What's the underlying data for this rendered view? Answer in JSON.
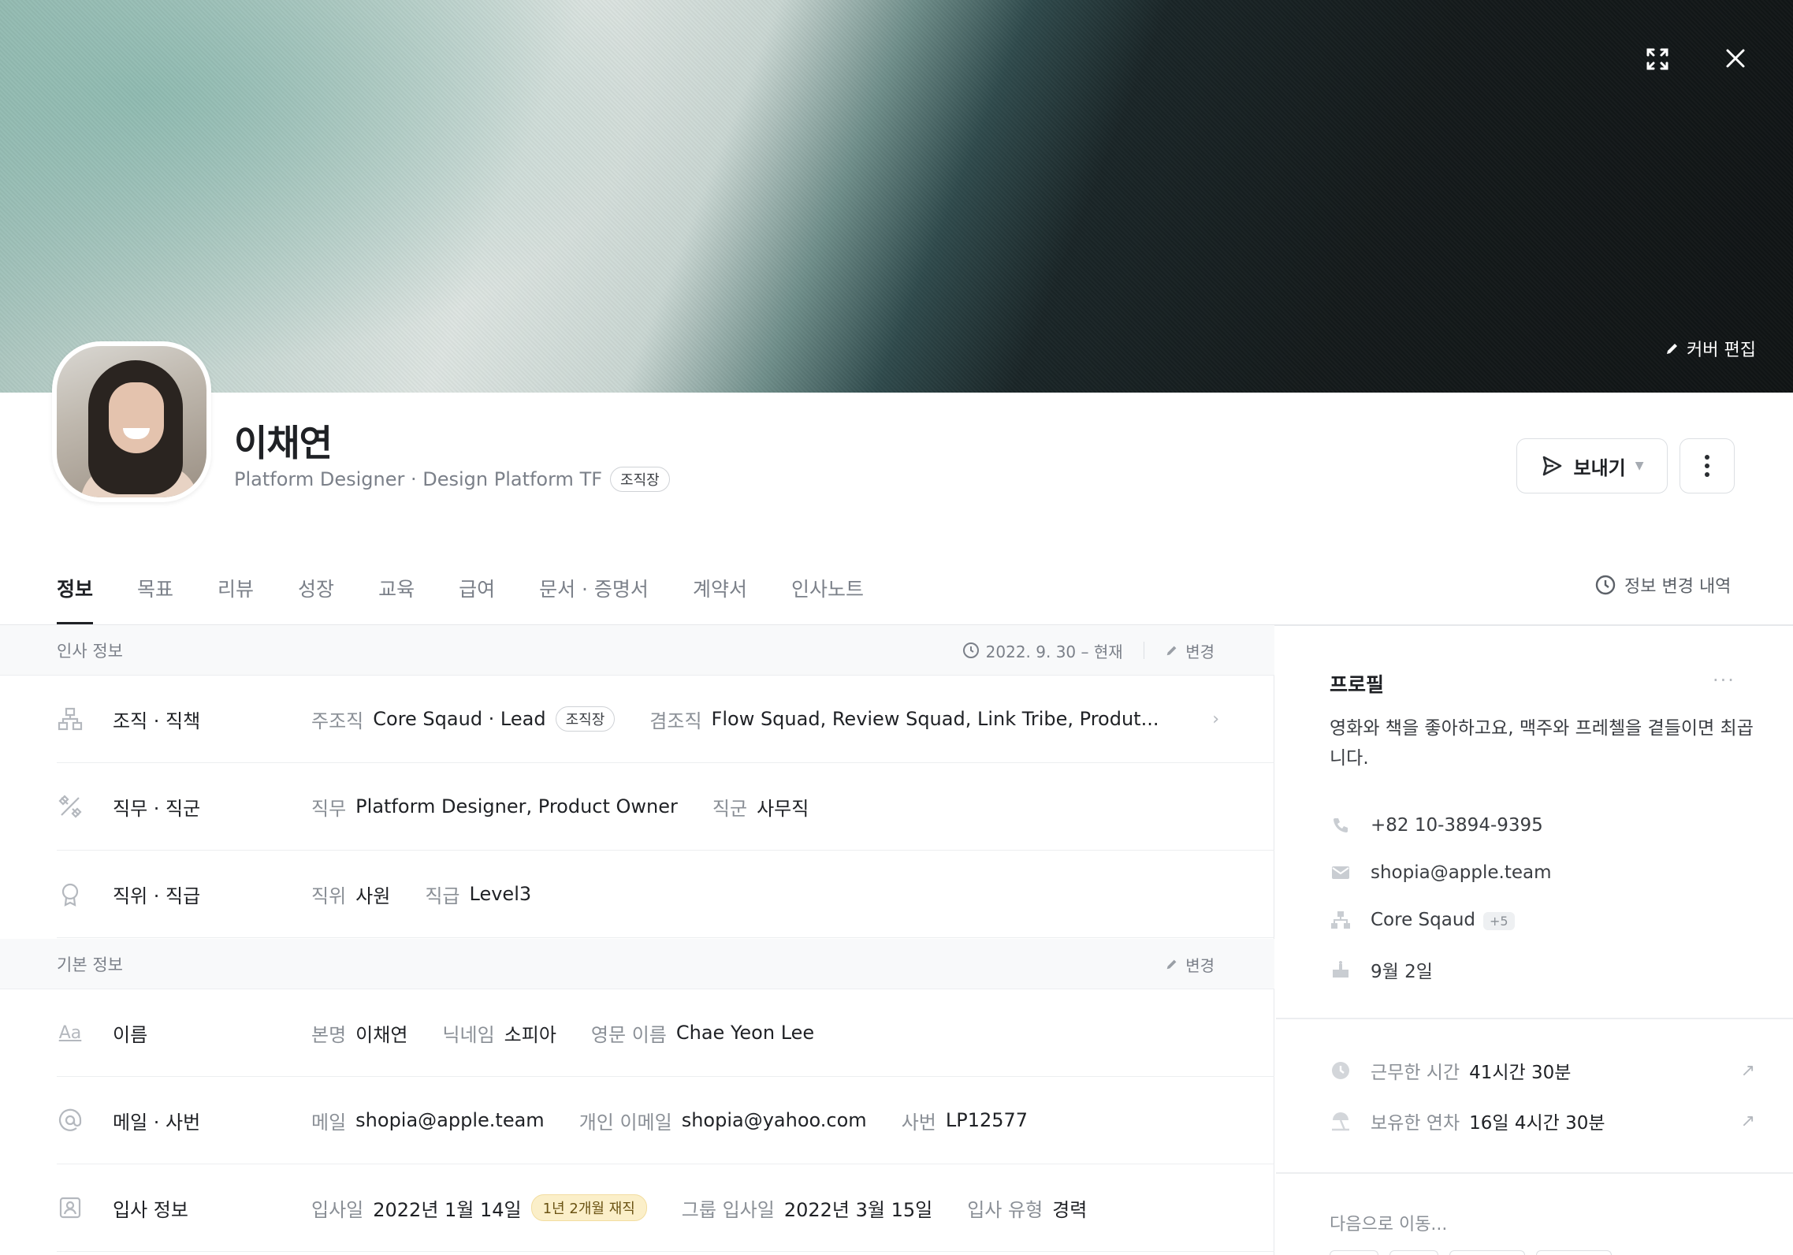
{
  "cover": {
    "edit_label": "커버 편집"
  },
  "header": {
    "name": "이채연",
    "subtitle": "Platform Designer · Design Platform TF",
    "role_badge": "조직장",
    "send_label": "보내기"
  },
  "tabs": [
    "정보",
    "목표",
    "리뷰",
    "성장",
    "교육",
    "급여",
    "문서 · 증명서",
    "계약서",
    "인사노트"
  ],
  "history_label": "정보 변경 내역",
  "hr_section": {
    "title": "인사 정보",
    "period": "2022. 9. 30 – 현재",
    "edit_label": "변경",
    "rows": [
      {
        "label": "조직 · 직책",
        "k1": "주조직",
        "v1": "Core Sqaud · Lead",
        "badge": "조직장",
        "k2": "겸조직",
        "v2": "Flow Squad, Review Squad, Link Tribe, Produt..."
      },
      {
        "label": "직무 · 직군",
        "k1": "직무",
        "v1": "Platform Designer,  Product Owner",
        "k2": "직군",
        "v2": "사무직"
      },
      {
        "label": "직위 · 직급",
        "k1": "직위",
        "v1": "사원",
        "k2": "직급",
        "v2": "Level3"
      }
    ]
  },
  "basic_section": {
    "title": "기본 정보",
    "edit_label": "변경",
    "rows": [
      {
        "label": "이름",
        "icon_text": "Aa",
        "k1": "본명",
        "v1": "이채연",
        "k2": "닉네임",
        "v2": "소피아",
        "k3": "영문 이름",
        "v3": "Chae Yeon Lee"
      },
      {
        "label": "메일 · 사번",
        "k1": "메일",
        "v1": "shopia@apple.team",
        "k2": "개인 이메일",
        "v2": "shopia@yahoo.com",
        "k3": "사번",
        "v3": "LP12577"
      },
      {
        "label": "입사 정보",
        "k1": "입사일",
        "v1": "2022년 1월 14일",
        "badge": "1년 2개월 재직",
        "k2": "그룹 입사일",
        "v2": "2022년 3월 15일",
        "k3": "입사 유형",
        "v3": "경력"
      }
    ]
  },
  "profile": {
    "title": "프로필",
    "bio": "영화와 책을 좋아하고요, 맥주와 프레첼을 곁들이면 최곱니다.",
    "phone": "+82 10-3894-9395",
    "email": "shopia@apple.team",
    "org": "Core Sqaud",
    "org_more": "+5",
    "birthday": "9월 2일"
  },
  "stats": [
    {
      "label": "근무한 시간",
      "value": "41시간 30분"
    },
    {
      "label": "보유한 연차",
      "value": "16일 4시간 30분"
    }
  ],
  "next_label": "다음으로 이동..."
}
